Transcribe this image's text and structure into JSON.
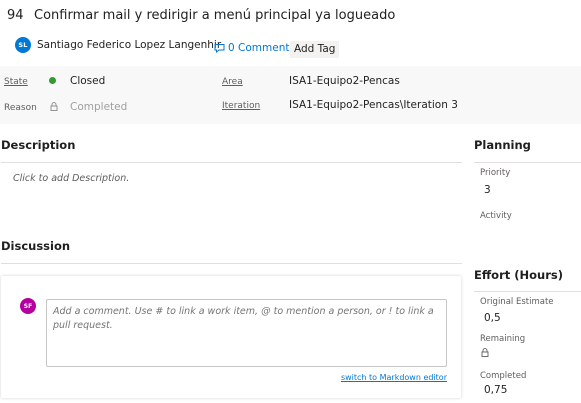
{
  "work_item": {
    "id": "94",
    "title": "Confirmar mail y redirigir a menú principal ya logueado",
    "assignee": {
      "initials": "SL",
      "name": "Santiago Federico Lopez Langenhir",
      "avatar_color": "#0078d4"
    },
    "comments_link": "0 Comments",
    "add_tag_label": "Add Tag"
  },
  "fields": {
    "state_label": "State",
    "state_value": "Closed",
    "state_color": "#339933",
    "reason_label": "Reason",
    "reason_value": "Completed",
    "area_label": "Area",
    "area_value": "ISA1-Equipo2-Pencas",
    "iteration_label": "Iteration",
    "iteration_value": "ISA1-Equipo2-Pencas\\Iteration 3"
  },
  "description": {
    "heading": "Description",
    "placeholder": "Click to add Description."
  },
  "discussion": {
    "heading": "Discussion",
    "user_initials": "SF",
    "user_avatar_color": "#b4009e",
    "comment_placeholder": "Add a comment. Use # to link a work item, @ to mention a person, or ! to link a pull request.",
    "markdown_link": "switch to Markdown editor"
  },
  "planning": {
    "heading": "Planning",
    "priority_label": "Priority",
    "priority_value": "3",
    "activity_label": "Activity"
  },
  "effort": {
    "heading": "Effort (Hours)",
    "original_estimate_label": "Original Estimate",
    "original_estimate_value": "0,5",
    "remaining_label": "Remaining",
    "completed_label": "Completed",
    "completed_value": "0,75"
  },
  "icons": {
    "comment": "speech-bubble-icon",
    "lock": "lock-icon"
  }
}
